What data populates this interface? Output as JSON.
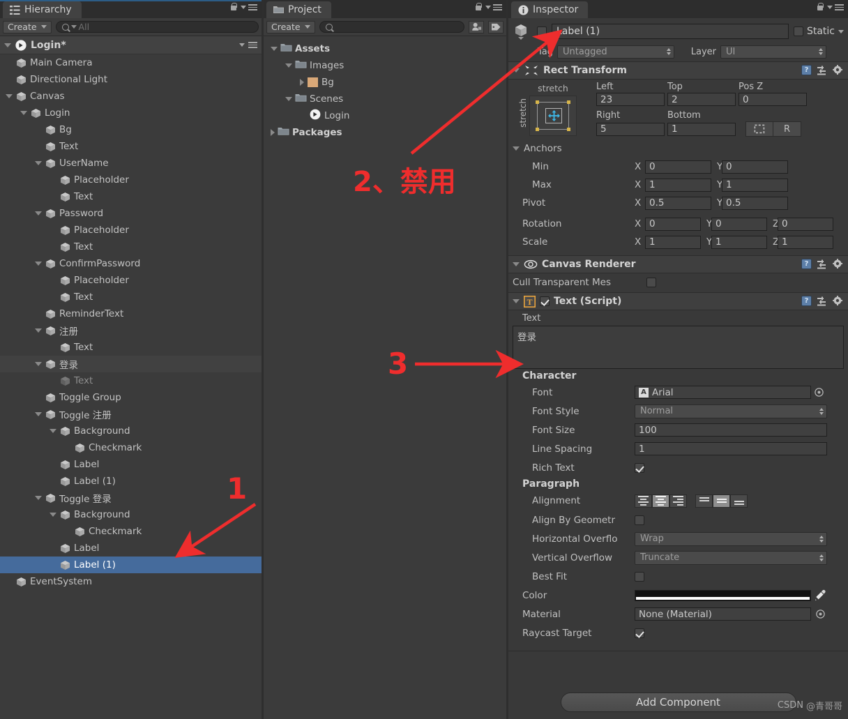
{
  "hierarchy": {
    "tab_label": "Hierarchy",
    "tab_icon": "hierarchy-icon",
    "create_label": "Create",
    "search_placeholder": "All",
    "search_value": "",
    "scene_name": "Login*",
    "items": [
      {
        "label": "Main Camera",
        "depth": 1,
        "arrow": "none",
        "state": "normal"
      },
      {
        "label": "Directional Light",
        "depth": 1,
        "arrow": "none",
        "state": "normal"
      },
      {
        "label": "Canvas",
        "depth": 1,
        "arrow": "down",
        "state": "normal"
      },
      {
        "label": "Login",
        "depth": 2,
        "arrow": "down",
        "state": "normal"
      },
      {
        "label": "Bg",
        "depth": 3,
        "arrow": "none",
        "state": "normal"
      },
      {
        "label": "Text",
        "depth": 3,
        "arrow": "none",
        "state": "normal"
      },
      {
        "label": "UserName",
        "depth": 3,
        "arrow": "down",
        "state": "normal"
      },
      {
        "label": "Placeholder",
        "depth": 4,
        "arrow": "none",
        "state": "normal"
      },
      {
        "label": "Text",
        "depth": 4,
        "arrow": "none",
        "state": "normal"
      },
      {
        "label": "Password",
        "depth": 3,
        "arrow": "down",
        "state": "normal"
      },
      {
        "label": "Placeholder",
        "depth": 4,
        "arrow": "none",
        "state": "normal"
      },
      {
        "label": "Text",
        "depth": 4,
        "arrow": "none",
        "state": "normal"
      },
      {
        "label": "ConfirmPassword",
        "depth": 3,
        "arrow": "down",
        "state": "normal"
      },
      {
        "label": "Placeholder",
        "depth": 4,
        "arrow": "none",
        "state": "normal"
      },
      {
        "label": "Text",
        "depth": 4,
        "arrow": "none",
        "state": "normal"
      },
      {
        "label": "ReminderText",
        "depth": 3,
        "arrow": "none",
        "state": "normal"
      },
      {
        "label": "注册",
        "depth": 3,
        "arrow": "down",
        "state": "normal"
      },
      {
        "label": "Text",
        "depth": 4,
        "arrow": "none",
        "state": "normal"
      },
      {
        "label": "登录",
        "depth": 3,
        "arrow": "down",
        "state": "alt"
      },
      {
        "label": "Text",
        "depth": 4,
        "arrow": "none",
        "state": "dim"
      },
      {
        "label": "Toggle Group",
        "depth": 3,
        "arrow": "none",
        "state": "normal"
      },
      {
        "label": "Toggle 注册",
        "depth": 3,
        "arrow": "down",
        "state": "normal"
      },
      {
        "label": "Background",
        "depth": 4,
        "arrow": "down",
        "state": "normal"
      },
      {
        "label": "Checkmark",
        "depth": 5,
        "arrow": "none",
        "state": "normal"
      },
      {
        "label": "Label",
        "depth": 4,
        "arrow": "none",
        "state": "normal"
      },
      {
        "label": "Label (1)",
        "depth": 4,
        "arrow": "none",
        "state": "normal"
      },
      {
        "label": "Toggle 登录",
        "depth": 3,
        "arrow": "down",
        "state": "normal"
      },
      {
        "label": "Background",
        "depth": 4,
        "arrow": "down",
        "state": "normal"
      },
      {
        "label": "Checkmark",
        "depth": 5,
        "arrow": "none",
        "state": "normal"
      },
      {
        "label": "Label",
        "depth": 4,
        "arrow": "none",
        "state": "normal"
      },
      {
        "label": "Label (1)",
        "depth": 4,
        "arrow": "none",
        "state": "selected"
      },
      {
        "label": "EventSystem",
        "depth": 1,
        "arrow": "none",
        "state": "normal"
      }
    ]
  },
  "project": {
    "tab_label": "Project",
    "tab_icon": "folder-icon",
    "create_label": "Create",
    "search_placeholder": "",
    "search_value": "",
    "toolbar_icons": [
      "favorites-icon",
      "label-icon"
    ],
    "items": [
      {
        "label": "Assets",
        "depth": 0,
        "arrow": "down",
        "icon": "folder-icon",
        "bold": true
      },
      {
        "label": "Images",
        "depth": 1,
        "arrow": "down",
        "icon": "folder-icon",
        "bold": false
      },
      {
        "label": "Bg",
        "depth": 2,
        "arrow": "right",
        "icon": "texture-icon",
        "bold": false
      },
      {
        "label": "Scenes",
        "depth": 1,
        "arrow": "down",
        "icon": "folder-icon",
        "bold": false
      },
      {
        "label": "Login",
        "depth": 2,
        "arrow": "none",
        "icon": "unity-scene-icon",
        "bold": false
      },
      {
        "label": "Packages",
        "depth": 0,
        "arrow": "right",
        "icon": "folder-icon",
        "bold": true
      }
    ]
  },
  "inspector": {
    "tab_label": "Inspector",
    "tab_icon": "info-icon",
    "object_enabled": false,
    "object_name": "Label (1)",
    "static_label": "Static",
    "static_checked": false,
    "tag_label": "Tag",
    "tag_value": "Untagged",
    "layer_label": "Layer",
    "layer_value": "UI",
    "rect_transform": {
      "title": "Rect Transform",
      "anchor_preset_top": "stretch",
      "anchor_preset_left": "stretch",
      "left_label": "Left",
      "left_value": "23",
      "top_label": "Top",
      "top_value": "2",
      "posz_label": "Pos Z",
      "posz_value": "0",
      "right_label": "Right",
      "right_value": "5",
      "bottom_label": "Bottom",
      "bottom_value": "1",
      "blueprint_button": "blueprint-mode-icon",
      "raw_button": "R",
      "anchors_label": "Anchors",
      "min_label": "Min",
      "min_x": "0",
      "min_y": "0",
      "max_label": "Max",
      "max_x": "1",
      "max_y": "1",
      "pivot_label": "Pivot",
      "pivot_x": "0.5",
      "pivot_y": "0.5",
      "rotation_label": "Rotation",
      "rot_x": "0",
      "rot_y": "0",
      "rot_z": "0",
      "scale_label": "Scale",
      "scale_x": "1",
      "scale_y": "1",
      "scale_z": "1",
      "axis_x": "X",
      "axis_y": "Y",
      "axis_z": "Z"
    },
    "canvas_renderer": {
      "title": "Canvas Renderer",
      "cull_label": "Cull Transparent Mes",
      "cull_checked": false
    },
    "text_script": {
      "title": "Text (Script)",
      "enabled": true,
      "text_label": "Text",
      "text_value": "登录",
      "character_header": "Character",
      "font_label": "Font",
      "font_value": "Arial",
      "font_style_label": "Font Style",
      "font_style_value": "Normal",
      "font_size_label": "Font Size",
      "font_size_value": "100",
      "line_spacing_label": "Line Spacing",
      "line_spacing_value": "1",
      "rich_text_label": "Rich Text",
      "rich_text_checked": true,
      "paragraph_header": "Paragraph",
      "alignment_label": "Alignment",
      "alignment_h_selected": 1,
      "alignment_v_selected": 1,
      "align_geometry_label": "Align By Geometr",
      "align_geometry_checked": false,
      "h_overflow_label": "Horizontal Overflo",
      "h_overflow_value": "Wrap",
      "v_overflow_label": "Vertical Overflow",
      "v_overflow_value": "Truncate",
      "best_fit_label": "Best Fit",
      "best_fit_checked": false,
      "color_label": "Color",
      "color_value": "#FFFFFF",
      "material_label": "Material",
      "material_value": "None (Material)",
      "raycast_label": "Raycast Target",
      "raycast_checked": true
    },
    "add_component_label": "Add Component"
  },
  "annotations": [
    {
      "id": "anno-1",
      "text": "1"
    },
    {
      "id": "anno-2",
      "text": "2、禁用"
    },
    {
      "id": "anno-3",
      "text": "3"
    }
  ],
  "watermark": {
    "prefix": "CSDN",
    "handle": "@青哥哥"
  },
  "colors": {
    "accent": "#456b9c",
    "annotation": "#ef2d2d",
    "panel_bg": "#393939"
  }
}
